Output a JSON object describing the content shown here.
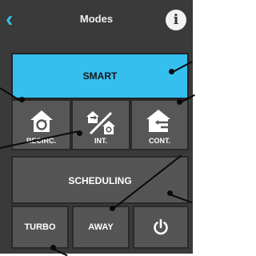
{
  "header": {
    "title": "Modes"
  },
  "buttons": {
    "smart": "SMART",
    "recirc": "RECIRC.",
    "int": "INT.",
    "cont": "CONT.",
    "scheduling": "SCHEDULING",
    "turbo": "TURBO",
    "away": "AWAY"
  },
  "icons": {
    "back": "chevron-left-icon",
    "info": "info-icon",
    "recirc": "house-recirculate-icon",
    "int": "house-intermittent-icon",
    "cont": "house-continuous-icon",
    "power": "power-icon"
  },
  "colors": {
    "accent": "#35bfef",
    "panel": "#3a3a3a",
    "tile": "#555555"
  }
}
